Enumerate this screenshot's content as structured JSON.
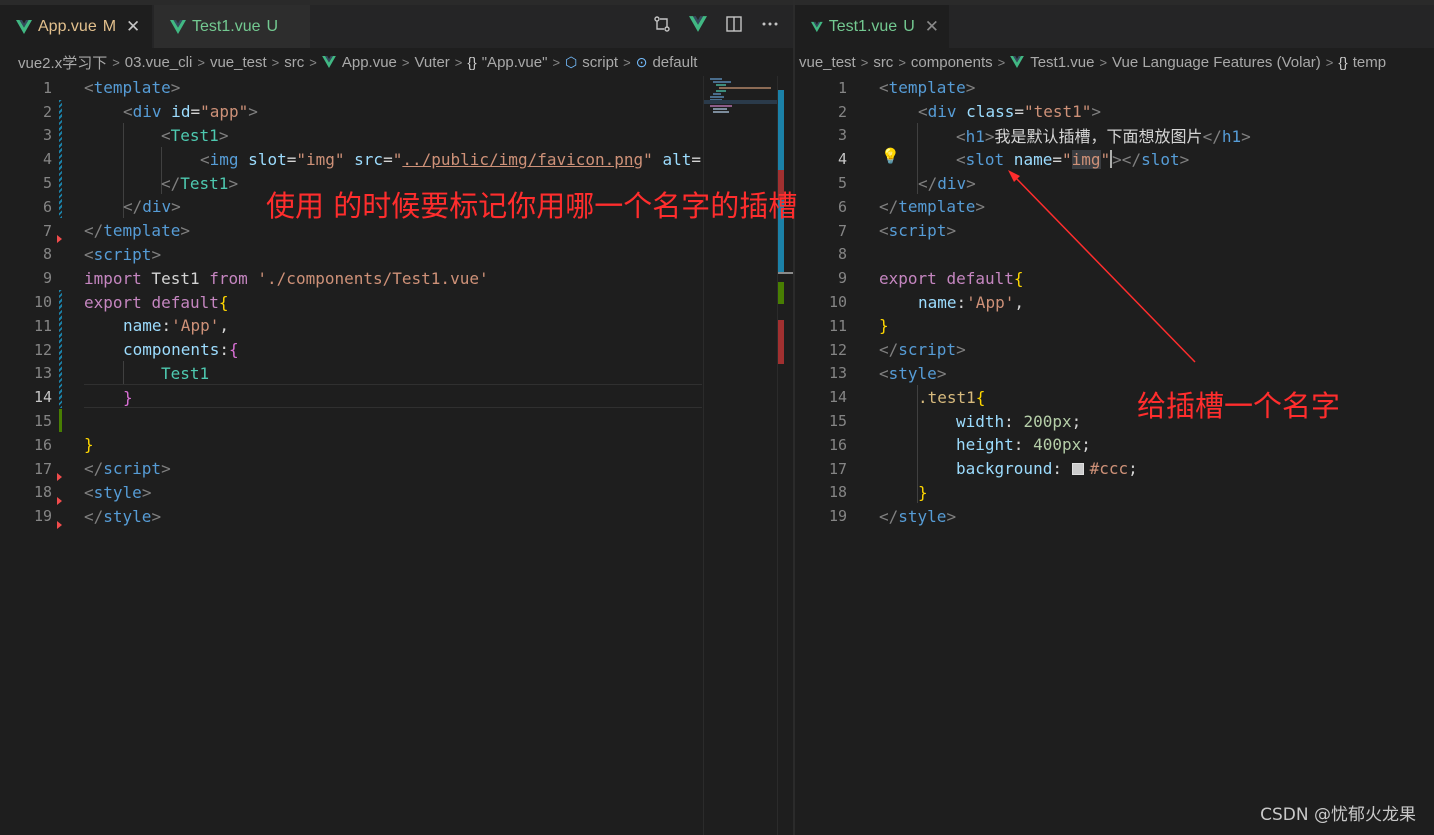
{
  "left": {
    "tabs": [
      {
        "name": "App.vue",
        "status": "M",
        "close": "✕"
      },
      {
        "name": "Test1.vue",
        "status": "U"
      }
    ],
    "breadcrumb": [
      "vue2.x学习下",
      "03.vue_cli",
      "vue_test",
      "src",
      "App.vue",
      "Vuter",
      "\"App.vue\"",
      "script",
      "default"
    ],
    "line_numbers": [
      "1",
      "2",
      "3",
      "4",
      "5",
      "6",
      "7",
      "8",
      "9",
      "10",
      "11",
      "12",
      "13",
      "14",
      "15",
      "16",
      "17",
      "18",
      "19"
    ],
    "code": {
      "l1": {
        "a": "<",
        "b": "template",
        "c": ">"
      },
      "l2": {
        "a": "<",
        "b": "div",
        "c": " id",
        "d": "=",
        "e": "\"app\"",
        "f": ">"
      },
      "l3": {
        "a": "<",
        "b": "Test1",
        "c": ">"
      },
      "l4": {
        "a": "<",
        "b": "img",
        "c": " slot",
        "d": "=",
        "e": "\"img\"",
        "f": " src",
        "g": "=",
        "h": "\"",
        "i": "../public/img/favicon.png",
        "j": "\"",
        "k": " alt",
        "l": "=\""
      },
      "l5": {
        "a": "</",
        "b": "Test1",
        "c": ">"
      },
      "l6": {
        "a": "</",
        "b": "div",
        "c": ">"
      },
      "l7": {
        "a": "</",
        "b": "template",
        "c": ">"
      },
      "l8": {
        "a": "<",
        "b": "script",
        "c": ">"
      },
      "l9": {
        "a": "import",
        "b": " Test1 ",
        "c": "from",
        "d": " ",
        "e": "'./components/Test1.vue'"
      },
      "l10": {
        "a": "export",
        "b": " ",
        "c": "default",
        "d": "{"
      },
      "l11": {
        "a": "name",
        "b": ":",
        "c": "'App'",
        "d": ","
      },
      "l12": {
        "a": "components",
        "b": ":",
        "c": "{"
      },
      "l13": {
        "a": "Test1"
      },
      "l14": {
        "a": "}"
      },
      "l16": {
        "a": "}"
      },
      "l17": {
        "a": "</",
        "b": "script",
        "c": ">"
      },
      "l18": {
        "a": "<",
        "b": "style",
        "c": ">"
      },
      "l19": {
        "a": "</",
        "b": "style",
        "c": ">"
      }
    },
    "annotation": "使用 的时候要标记你用哪一个名字的插槽"
  },
  "right": {
    "tabs": [
      {
        "name": "Test1.vue",
        "status": "U",
        "close": "✕"
      }
    ],
    "breadcrumb": [
      "vue_test",
      "src",
      "components",
      "Test1.vue",
      "Vue Language Features (Volar)",
      "temp"
    ],
    "line_numbers": [
      "1",
      "2",
      "3",
      "4",
      "5",
      "6",
      "7",
      "8",
      "9",
      "10",
      "11",
      "12",
      "13",
      "14",
      "15",
      "16",
      "17",
      "18",
      "19"
    ],
    "code": {
      "l1": {
        "a": "<",
        "b": "template",
        "c": ">"
      },
      "l2": {
        "a": "<",
        "b": "div",
        "c": " class",
        "d": "=",
        "e": "\"test1\"",
        "f": ">"
      },
      "l3": {
        "a": "<",
        "b": "h1",
        "c": ">",
        "d": "我是默认插槽，下面想放图片",
        "e": "</",
        "f": "h1",
        "g": ">"
      },
      "l4": {
        "a": "<",
        "b": "slot",
        "c": " name",
        "d": "=",
        "e": "\"",
        "f": "img",
        "g": "\"",
        "h": "></",
        "i": "slot",
        "j": ">"
      },
      "l5": {
        "a": "</",
        "b": "div",
        "c": ">"
      },
      "l6": {
        "a": "</",
        "b": "template",
        "c": ">"
      },
      "l7": {
        "a": "<",
        "b": "script",
        "c": ">"
      },
      "l9": {
        "a": "export",
        "b": " ",
        "c": "default",
        "d": "{"
      },
      "l10": {
        "a": "name",
        "b": ":",
        "c": "'App'",
        "d": ","
      },
      "l11": {
        "a": "}"
      },
      "l12": {
        "a": "</",
        "b": "script",
        "c": ">"
      },
      "l13": {
        "a": "<",
        "b": "style",
        "c": ">"
      },
      "l14": {
        "a": ".test1",
        "b": "{"
      },
      "l15": {
        "a": "width",
        "b": ": ",
        "c": "200px",
        "d": ";"
      },
      "l16": {
        "a": "height",
        "b": ": ",
        "c": "400px",
        "d": ";"
      },
      "l17": {
        "a": "background",
        "b": ": ",
        "c": "#ccc",
        "d": ";"
      },
      "l18": {
        "a": "}"
      },
      "l19": {
        "a": "</",
        "b": "style",
        "c": ">"
      }
    },
    "annotation": "给插槽一个名字"
  },
  "watermark": "CSDN @忧郁火龙果",
  "colors": {
    "annotation": "#ff2d2d",
    "modified": "#e2c08d",
    "untracked": "#73c991"
  }
}
